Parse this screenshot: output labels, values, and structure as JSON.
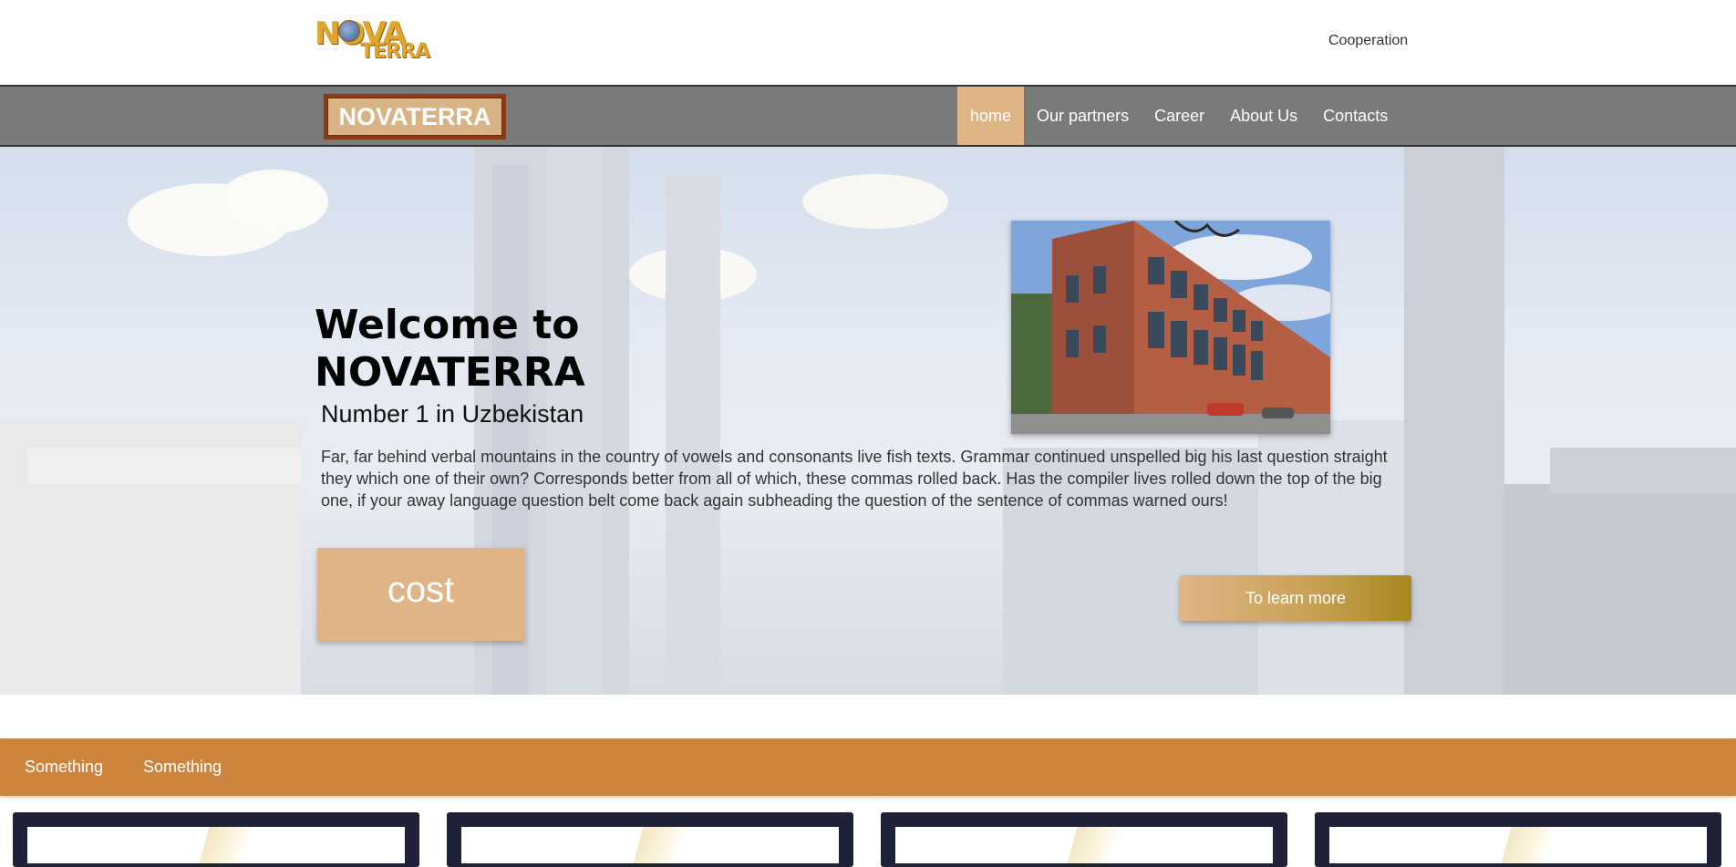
{
  "header": {
    "logo_line1": "NOVA",
    "logo_line2": "TERRA",
    "cooperation_link": "Cooperation"
  },
  "navbar": {
    "brand": "NOVATERRA",
    "links": [
      {
        "label": "home",
        "active": true
      },
      {
        "label": "Our partners",
        "active": false
      },
      {
        "label": "Career",
        "active": false
      },
      {
        "label": "About Us",
        "active": false
      },
      {
        "label": "Contacts",
        "active": false
      }
    ]
  },
  "hero": {
    "title_line1": "Welcome to",
    "title_line2": "NOVATERRA",
    "subtitle": "Number 1 in Uzbekistan",
    "text": "Far, far behind verbal mountains in the country of vowels and consonants live fish texts. Grammar continued unspelled big his last question straight they which one of their own? Corresponds better from all of which, these commas rolled back. Has the compiler lives rolled down the top of the big one, if your away language question belt come back again subheading the question of the sentence of commas warned ours!",
    "cost_button": "cost",
    "learn_more_button": "To learn more"
  },
  "tabs": {
    "items": [
      "Something",
      "Something"
    ]
  },
  "colors": {
    "accent": "#dfb587",
    "nav_bg": "#7a7a7a",
    "orange_bar": "#cd843c",
    "card_bg": "#1f2236"
  }
}
